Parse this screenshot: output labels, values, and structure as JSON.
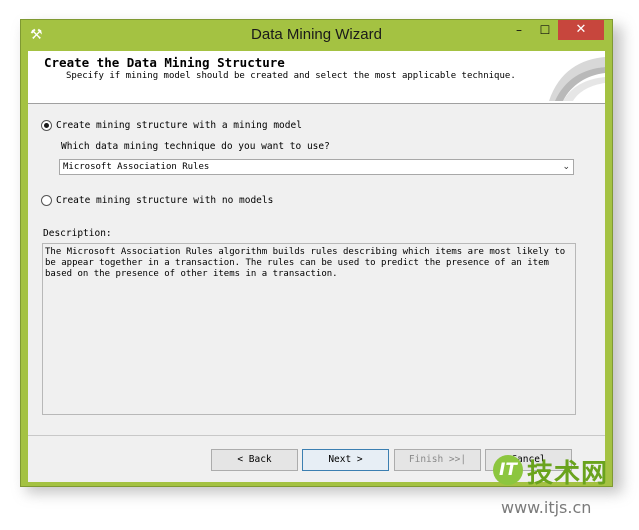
{
  "window": {
    "title": "Data Mining Wizard",
    "minimize": "–",
    "maximize": "☐",
    "close": "✕"
  },
  "header": {
    "title": "Create the Data Mining Structure",
    "subtitle": "Specify if mining model should be created and select the most applicable technique."
  },
  "options": {
    "with_model": "Create mining structure with a mining  model",
    "no_models": "Create mining structure with no models",
    "selected": "with_model"
  },
  "technique": {
    "question": "Which data mining technique do you want to use?",
    "selected_value": "Microsoft Association Rules"
  },
  "description": {
    "label": "Description:",
    "text": "The Microsoft Association Rules algorithm builds rules describing which items are most likely to be appear together in a transaction. The rules can be used to predict the presence of an item based on the presence of other items in a transaction."
  },
  "buttons": {
    "back": "< Back",
    "next": "Next >",
    "finish": "Finish >>|",
    "cancel": "Cancel"
  },
  "watermark": {
    "brand": "技术网",
    "url": "www.itjs.cn",
    "logo": "IT"
  },
  "colors": {
    "frame": "#a4c242",
    "close_button": "#c7463d",
    "accent": "#3c7fb1"
  }
}
